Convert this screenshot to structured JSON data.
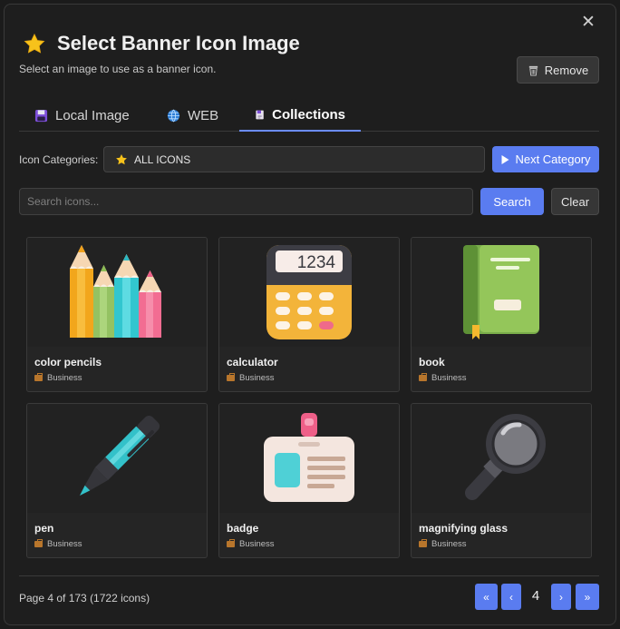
{
  "dialog": {
    "title": "Select Banner Icon Image",
    "subtitle": "Select an image to use as a banner icon.",
    "close_label": "✕",
    "remove_label": "Remove"
  },
  "tabs": [
    {
      "label": "Local Image",
      "icon": "floppy-disk-icon",
      "active": false
    },
    {
      "label": "WEB",
      "icon": "globe-icon",
      "active": false
    },
    {
      "label": "Collections",
      "icon": "book-icon",
      "active": true
    }
  ],
  "categories": {
    "label": "Icon Categories:",
    "selected": "ALL ICONS",
    "next_label": "Next Category"
  },
  "search": {
    "placeholder": "Search icons...",
    "value": "",
    "search_label": "Search",
    "clear_label": "Clear"
  },
  "icons": [
    {
      "name": "color pencils",
      "category": "Business",
      "art": "color-pencils"
    },
    {
      "name": "calculator",
      "category": "Business",
      "art": "calculator"
    },
    {
      "name": "book",
      "category": "Business",
      "art": "book"
    },
    {
      "name": "pen",
      "category": "Business",
      "art": "pen"
    },
    {
      "name": "badge",
      "category": "Business",
      "art": "badge"
    },
    {
      "name": "magnifying glass",
      "category": "Business",
      "art": "magnifying-glass"
    }
  ],
  "calculator_display": "1234",
  "pagination": {
    "info": "Page 4 of 173 (1722 icons)",
    "current_page": "4",
    "first_label": "«",
    "prev_label": "‹",
    "next_label": "›",
    "last_label": "»"
  },
  "colors": {
    "accent": "#5a7cf0",
    "tab_underline": "#6b8cff",
    "dialog_bg": "#1e1e1e"
  }
}
